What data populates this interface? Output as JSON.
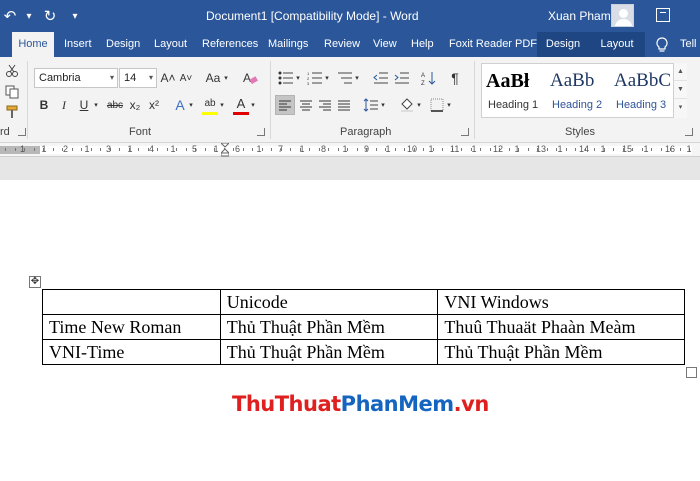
{
  "title_bar": {
    "document_title": "Document1 [Compatibility Mode]  -  Word",
    "user_name": "Xuan Pham",
    "qat": {
      "undo_icon": "↶",
      "redo_icon": "↻",
      "customize_icon": "▾"
    },
    "window_button_icon": "ribbon-display-options-icon"
  },
  "tabs": [
    {
      "label": "Home",
      "active": true
    },
    {
      "label": "Insert"
    },
    {
      "label": "Design"
    },
    {
      "label": "Layout"
    },
    {
      "label": "References"
    },
    {
      "label": "Mailings"
    },
    {
      "label": "Review"
    },
    {
      "label": "View"
    },
    {
      "label": "Help"
    },
    {
      "label": "Foxit Reader PDF"
    },
    {
      "label": "Design",
      "contextual": true
    },
    {
      "label": "Layout",
      "contextual": true
    }
  ],
  "tell_me": "Tell",
  "ribbon": {
    "clipboard_label": "rd",
    "font": {
      "label": "Font",
      "name": "Cambria",
      "size": "14",
      "grow_icon": "A˄",
      "shrink_icon": "A˅",
      "case_icon": "Aa",
      "bold": "B",
      "italic": "I",
      "underline": "U",
      "strike": "abc",
      "subscript": "x₂",
      "superscript": "x²",
      "text_effects": "A",
      "highlight": "ab",
      "font_color": "A",
      "highlight_color": "#ffff00",
      "font_color_value": "#e00000"
    },
    "paragraph": {
      "label": "Paragraph",
      "sort_icon": "↕",
      "pilcrow": "¶"
    },
    "styles": {
      "label": "Styles",
      "items": [
        {
          "sample": "AaBł",
          "name": "Heading 1"
        },
        {
          "sample": "AaBb",
          "name": "Heading 2"
        },
        {
          "sample": "AaBbC",
          "name": "Heading 3"
        }
      ]
    }
  },
  "ruler": {
    "numbers": [
      "1",
      "1",
      "2",
      "1",
      "3",
      "1",
      "4",
      "1",
      "5",
      "1",
      "6",
      "1",
      "7",
      "1",
      "8",
      "1",
      "9",
      "1",
      "10",
      "1",
      "11",
      "1",
      "12",
      "1",
      "13",
      "1",
      "14",
      "1",
      "15",
      "1",
      "16",
      "1"
    ]
  },
  "table": {
    "rows": [
      [
        "",
        "Unicode",
        "VNI Windows"
      ],
      [
        "Time New Roman",
        "Thủ Thuật Phần Mềm",
        "Thuû Thuaät Phaàn Meàm"
      ],
      [
        "VNI-Time",
        "Thủ Thuật Phần Mềm",
        "Thủ Thuật Phần Mềm"
      ]
    ]
  },
  "watermark": {
    "part1": "Thu",
    "part2": "Thuat",
    "part3": "PhanMem",
    "part4": ".vn"
  },
  "colors": {
    "word_blue": "#2b579a",
    "contextual_tab": "#1d4682"
  }
}
